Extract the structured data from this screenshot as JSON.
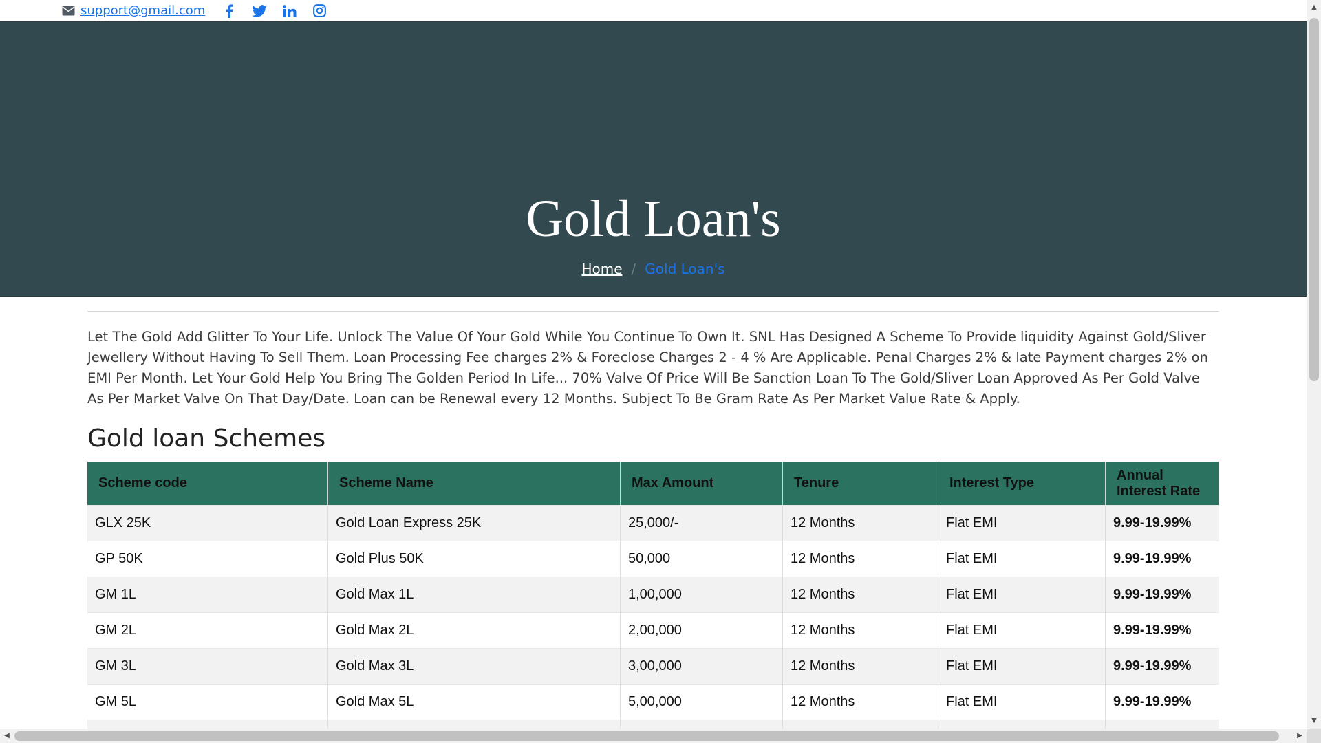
{
  "contact": {
    "email": "support@gmail.com"
  },
  "social": [
    "facebook-icon",
    "twitter-icon",
    "linkedin-icon",
    "instagram-icon"
  ],
  "hero": {
    "title": "Gold Loan's",
    "breadcrumb": {
      "home": "Home",
      "separator": "/",
      "current": "Gold Loan's"
    }
  },
  "intro": "Let The Gold Add Glitter To Your Life. Unlock The Value Of Your Gold While You Continue To Own It. SNL Has Designed A Scheme To Provide liquidity Against Gold/Sliver Jewellery Without Having To Sell Them. Loan Processing Fee charges 2% & Foreclose Charges 2 - 4 % Are Applicable. Penal Charges 2% & late Payment charges 2% on EMI Per Month. Let Your Gold Help You Bring The Golden Period In Life... 70% Valve Of Price Will Be Sanction Loan To The Gold/Sliver Loan Approved As Per Gold Valve As Per Market Valve On That Day/Date. Loan can be Renewal every 12 Months. Subject To Be Gram Rate As Per Market Value Rate & Apply.",
  "section_title": "Gold loan Schemes",
  "table": {
    "headers": [
      "Scheme code",
      "Scheme Name",
      "Max Amount",
      "Tenure",
      "Interest Type",
      "Annual Interest Rate"
    ],
    "rows": [
      [
        "GLX 25K",
        "Gold Loan Express 25K",
        "25,000/-",
        "12 Months",
        "Flat EMI",
        "9.99-19.99%"
      ],
      [
        "GP 50K",
        "Gold Plus 50K",
        "50,000",
        "12 Months",
        "Flat EMI",
        "9.99-19.99%"
      ],
      [
        "GM 1L",
        "Gold Max 1L",
        "1,00,000",
        "12 Months",
        "Flat EMI",
        "9.99-19.99%"
      ],
      [
        "GM 2L",
        "Gold Max 2L",
        "2,00,000",
        "12 Months",
        "Flat EMI",
        "9.99-19.99%"
      ],
      [
        "GM 3L",
        "Gold Max 3L",
        "3,00,000",
        "12 Months",
        "Flat EMI",
        "9.99-19.99%"
      ],
      [
        "GM 5L",
        "Gold Max 5L",
        "5,00,000",
        "12 Months",
        "Flat EMI",
        "9.99-19.99%"
      ],
      [
        "",
        "",
        "",
        "",
        "",
        ""
      ]
    ]
  },
  "scrollbars": {
    "up": "▲",
    "down": "▼",
    "left": "◀",
    "right": "▶"
  }
}
